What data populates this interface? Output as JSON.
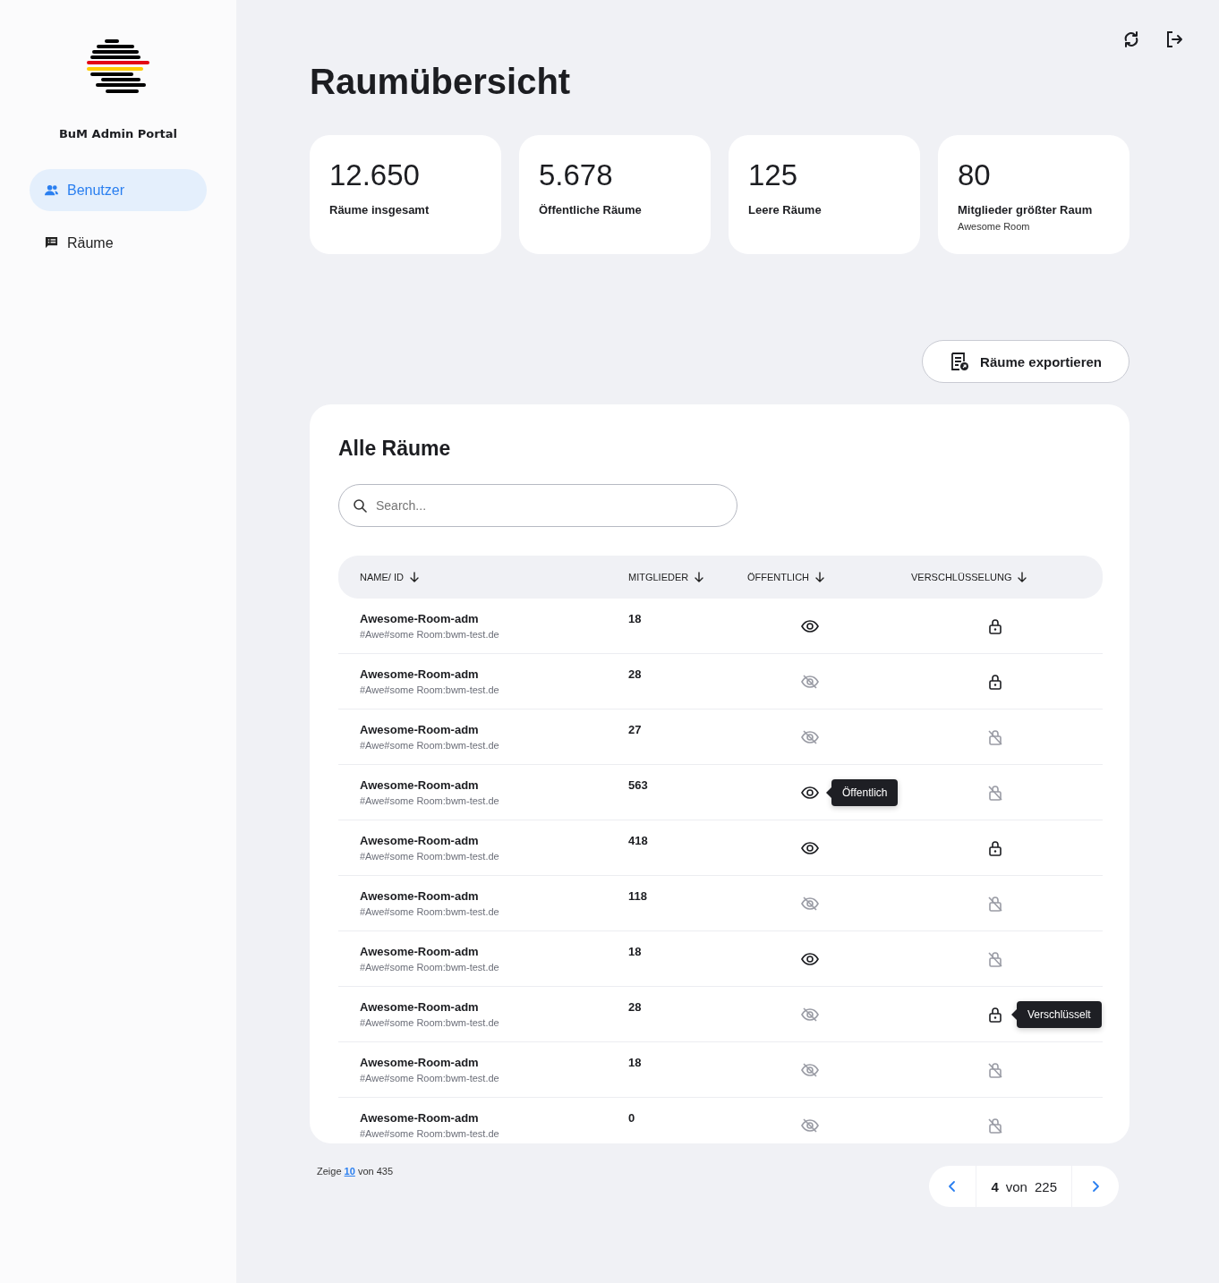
{
  "sidebar": {
    "brand": "BuM Admin Portal",
    "items": [
      {
        "label": "Benutzer",
        "kind": "people",
        "selected": true
      },
      {
        "label": "Räume",
        "kind": "list",
        "selected": false
      }
    ]
  },
  "page_title": "Raumübersicht",
  "stats": [
    {
      "value": "12.650",
      "label": "Räume insgesamt"
    },
    {
      "value": "5.678",
      "label": "Öffentliche Räume"
    },
    {
      "value": "125",
      "label": "Leere Räume"
    },
    {
      "value": "80",
      "label": "Mitglieder größter Raum",
      "detail": "Awesome Room"
    }
  ],
  "export_button": "Räume exportieren",
  "table": {
    "title": "Alle Räume",
    "search": {
      "placeholder": "Search..."
    },
    "columns": [
      "NAME/ ID",
      "MITGLIEDER",
      "ÖFFENTLICH",
      "VERSCHLÜSSELUNG"
    ],
    "rows": [
      {
        "name": "Awesome-Room-adm",
        "id": "#Awe#some Room:bwm-test.de",
        "members": "18",
        "public": true,
        "encrypted": true
      },
      {
        "name": "Awesome-Room-adm",
        "id": "#Awe#some Room:bwm-test.de",
        "members": "28",
        "public": false,
        "encrypted": true
      },
      {
        "name": "Awesome-Room-adm",
        "id": "#Awe#some Room:bwm-test.de",
        "members": "27",
        "public": false,
        "encrypted": false
      },
      {
        "name": "Awesome-Room-adm",
        "id": "#Awe#some Room:bwm-test.de",
        "members": "563",
        "public": true,
        "encrypted": false,
        "public_tooltip": "Öffentlich"
      },
      {
        "name": "Awesome-Room-adm",
        "id": "#Awe#some Room:bwm-test.de",
        "members": "418",
        "public": true,
        "encrypted": true
      },
      {
        "name": "Awesome-Room-adm",
        "id": "#Awe#some Room:bwm-test.de",
        "members": "118",
        "public": false,
        "encrypted": false
      },
      {
        "name": "Awesome-Room-adm",
        "id": "#Awe#some Room:bwm-test.de",
        "members": "18",
        "public": true,
        "encrypted": false
      },
      {
        "name": "Awesome-Room-adm",
        "id": "#Awe#some Room:bwm-test.de",
        "members": "28",
        "public": false,
        "encrypted": true,
        "encrypted_tooltip": "Verschlüsselt"
      },
      {
        "name": "Awesome-Room-adm",
        "id": "#Awe#some Room:bwm-test.de",
        "members": "18",
        "public": false,
        "encrypted": false
      },
      {
        "name": "Awesome-Room-adm",
        "id": "#Awe#some Room:bwm-test.de",
        "members": "0",
        "public": false,
        "encrypted": false
      }
    ]
  },
  "footer": {
    "summary_prefix": "Zeige",
    "page_size": "10",
    "summary_suffix": "von 435"
  },
  "pagination": {
    "current": "4",
    "of_label": "von",
    "total": "225"
  }
}
